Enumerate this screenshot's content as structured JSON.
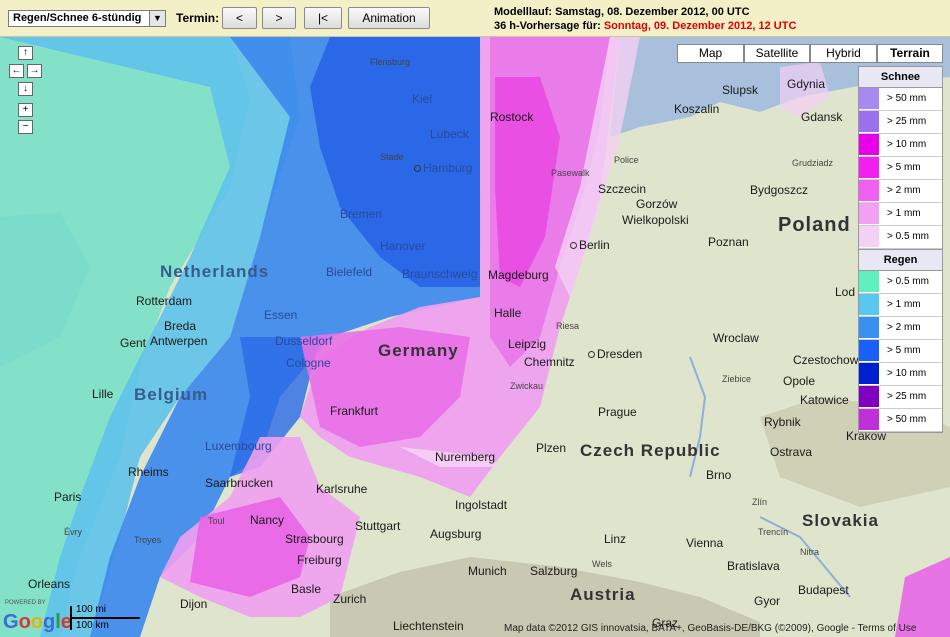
{
  "toolbar": {
    "product_select": "Regen/Schnee 6-stündig",
    "termin_label": "Termin:",
    "btn_prev": "<",
    "btn_next": ">",
    "btn_first": "|<",
    "btn_animation": "Animation",
    "model_run": "Modelllauf: Samstag, 08. Dezember 2012, 00 UTC",
    "forecast_prefix": "36 h-Vorhersage für: ",
    "forecast_date": "Sonntag, 09. Dezember 2012, 12 UTC"
  },
  "map_types": [
    "Map",
    "Satellite",
    "Hybrid",
    "Terrain"
  ],
  "nav": {
    "up": "↑",
    "left": "←",
    "right": "→",
    "down": "↓",
    "zoom_in": "+",
    "zoom_out": "−"
  },
  "legend": {
    "snow_title": "Schnee",
    "snow": [
      {
        "label": "> 50 mm",
        "color": "#a78af0"
      },
      {
        "label": "> 25 mm",
        "color": "#9a70ee"
      },
      {
        "label": "> 10 mm",
        "color": "#e800e8"
      },
      {
        "label": "> 5 mm",
        "color": "#f020f0"
      },
      {
        "label": "> 2 mm",
        "color": "#f060f0"
      },
      {
        "label": "> 1 mm",
        "color": "#f2a0f2"
      },
      {
        "label": "> 0.5 mm",
        "color": "#f4d0f4"
      }
    ],
    "rain_title": "Regen",
    "rain": [
      {
        "label": "> 0.5 mm",
        "color": "#60f0c0"
      },
      {
        "label": "> 1 mm",
        "color": "#58c8f0"
      },
      {
        "label": "> 2 mm",
        "color": "#3890f0"
      },
      {
        "label": "> 5 mm",
        "color": "#1860f8"
      },
      {
        "label": "> 10 mm",
        "color": "#0020d0"
      },
      {
        "label": "> 25 mm",
        "color": "#8000c0"
      },
      {
        "label": "> 50 mm",
        "color": "#c030d8"
      }
    ]
  },
  "labels": {
    "netherlands": "Netherlands",
    "belgium": "Belgium",
    "germany": "Germany",
    "poland": "Poland",
    "czech": "Czech Republic",
    "slovakia": "Slovakia",
    "austria": "Austria",
    "luxembourg": "Luxembourg",
    "flensburg": "Flensburg",
    "kiel": "Kiel",
    "lubeck": "Lubeck",
    "rostock": "Rostock",
    "stade": "Stade",
    "hamburg": "Hamburg",
    "bremen": "Bremen",
    "hanover": "Hanover",
    "bielefeld": "Bielefeld",
    "braunschweig": "Braunschweig",
    "magdeburg": "Magdeburg",
    "berlin": "Berlin",
    "rotterdam": "Rotterdam",
    "breda": "Breda",
    "antwerpen": "Antwerpen",
    "gent": "Gent",
    "lille": "Lille",
    "essen": "Essen",
    "dusseldorf": "Dusseldorf",
    "cologne": "Cologne",
    "halle": "Halle",
    "leipzig": "Leipzig",
    "riesa": "Riesa",
    "dresden": "Dresden",
    "chemnitz": "Chemnitz",
    "zwickau": "Zwickau",
    "frankfurt": "Frankfurt",
    "nuremberg": "Nuremberg",
    "rheims": "Rheims",
    "saarbrucken": "Saarbrucken",
    "nancy": "Nancy",
    "toul": "Toul",
    "karlsruhe": "Karlsruhe",
    "strasbourg": "Strasbourg",
    "stuttgart": "Stuttgart",
    "ingolstadt": "Ingolstadt",
    "augsburg": "Augsburg",
    "munich": "Munich",
    "salzburg": "Salzburg",
    "linz": "Linz",
    "wels": "Wels",
    "vienna": "Vienna",
    "bratislava": "Bratislava",
    "brno": "Brno",
    "prague": "Prague",
    "plzen": "Plzen",
    "paris": "Paris",
    "evry": "Évry",
    "troyes": "Troyes",
    "orleans": "Orleans",
    "dijon": "Dijon",
    "freiburg": "Freiburg",
    "basle": "Basle",
    "zurich": "Zurich",
    "liechtenstein": "Liechtenstein",
    "graz": "Graz",
    "gyor": "Gyor",
    "budapest": "Budapest",
    "slupsk": "Slupsk",
    "gdynia": "Gdynia",
    "gdansk": "Gdansk",
    "koszalin": "Koszalin",
    "police": "Police",
    "pasewalk": "Pasewalk",
    "szczecin": "Szczecin",
    "bydgoszcz": "Bydgoszcz",
    "grudziadz": "Grudziadz",
    "gorzow": "Gorzów",
    "wielkopolski": "Wielkopolski",
    "poznan": "Poznan",
    "wroclaw": "Wroclaw",
    "czestochowa": "Czestochowa",
    "opole": "Opole",
    "ziebice": "Ziebice",
    "katowice": "Katowice",
    "rybnik": "Rybnik",
    "ostrava": "Ostrava",
    "krakow": "Kraków",
    "zlin": "Zlín",
    "trencin": "Trencín",
    "nitra": "Nitra",
    "lodz": "Lod"
  },
  "attribution": {
    "powered": "POWERED BY",
    "google": "Google",
    "scale_mi": "100 mi",
    "scale_km": "100 km",
    "copyright": "Map data ©2012 GIS innovatsia, BATA+, GeoBasis-DE/BKG (©2009), Google - Terms of Use"
  }
}
